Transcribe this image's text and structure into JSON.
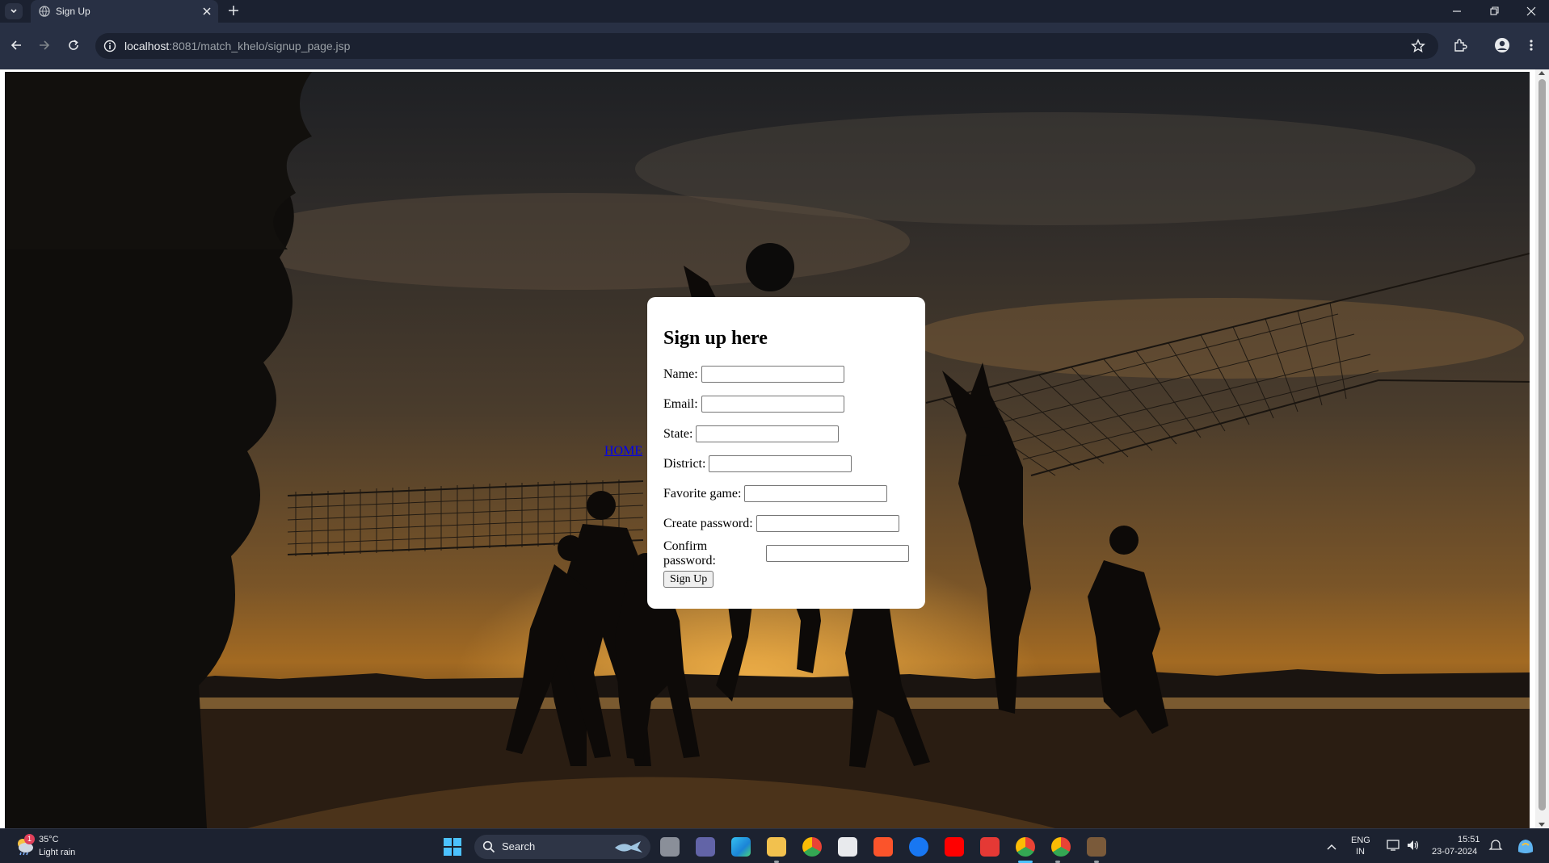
{
  "browser": {
    "tab_title": "Sign Up",
    "url_host": "localhost",
    "url_rest": ":8081/match_khelo/signup_page.jsp"
  },
  "page": {
    "home_link": "HOME",
    "form": {
      "heading": "Sign up here",
      "fields": [
        {
          "label": "Name:",
          "value": ""
        },
        {
          "label": "Email:",
          "value": ""
        },
        {
          "label": "State:",
          "value": ""
        },
        {
          "label": "District:",
          "value": ""
        },
        {
          "label": "Favorite game:",
          "value": ""
        },
        {
          "label": "Create password:",
          "value": ""
        },
        {
          "label": "Confirm password:",
          "value": ""
        }
      ],
      "submit_label": "Sign Up"
    }
  },
  "taskbar": {
    "weather_temp": "35°C",
    "weather_desc": "Light rain",
    "weather_badge": "1",
    "search_label": "Search",
    "lang_top": "ENG",
    "lang_bottom": "IN",
    "time": "15:51",
    "date": "23-07-2024"
  },
  "colors": {
    "chrome_dark": "#1b2130",
    "chrome_toolbar": "#283044",
    "link": "#0000ee",
    "taskbar_accent": "#4cc2ff"
  },
  "icons": [
    "tab-list-icon",
    "globe-icon",
    "close-icon",
    "plus-icon",
    "minimize-icon",
    "restore-icon",
    "back-icon",
    "forward-icon",
    "reload-icon",
    "info-icon",
    "star-icon",
    "extensions-icon",
    "profile-icon",
    "menu-icon",
    "windows-icon",
    "search-icon"
  ]
}
